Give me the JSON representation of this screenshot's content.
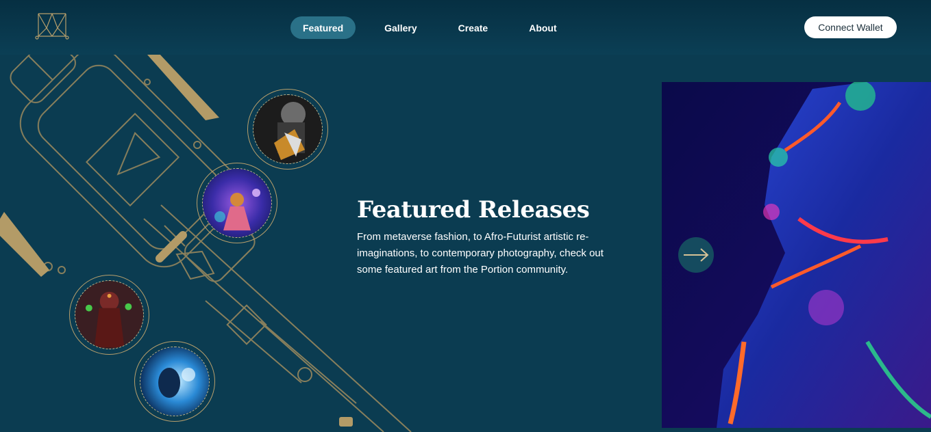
{
  "nav": {
    "items": [
      {
        "label": "Featured",
        "active": true
      },
      {
        "label": "Gallery",
        "active": false
      },
      {
        "label": "Create",
        "active": false
      },
      {
        "label": "About",
        "active": false
      }
    ],
    "connect_label": "Connect Wallet"
  },
  "hero": {
    "title": "Featured Releases",
    "description": "From metaverse fashion, to Afro-Futurist artistic re-imaginations, to contemporary photography, check out some featured art from the Portion community."
  },
  "colors": {
    "background": "#0b3c51",
    "header": "#062f42",
    "nav_active": "#2a7188",
    "gold_line": "#b79f6c"
  },
  "icons": {
    "logo": "portion-logo-icon",
    "next": "arrow-right-icon"
  }
}
